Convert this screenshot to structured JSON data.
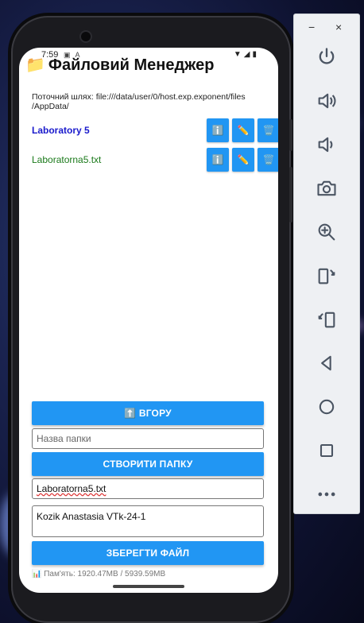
{
  "app": {
    "title": "Файловий Менеджер",
    "title_icon": "📁",
    "status_time": "7:59",
    "status_icons_left": "▣ A",
    "status_icons_right": "▼◢▮"
  },
  "path": {
    "label": "Поточний шлях: file:///data/user/0/host.exp.exponent/files /AppData/"
  },
  "items": [
    {
      "name": "Laboratory 5",
      "kind": "dir",
      "info": "ℹ️",
      "edit": "✏️",
      "delete": "🗑️"
    },
    {
      "name": "Laboratorna5.txt",
      "kind": "file",
      "info": "ℹ️",
      "edit": "✏️",
      "delete": "🗑️"
    }
  ],
  "controls": {
    "up_button": "⬆️ ВГОРУ",
    "folder_placeholder": "Назва папки",
    "create_button": "СТВОРИТИ ПАПКУ",
    "filename_value": "Laboratorna5.txt",
    "content_value": "Kozik Anastasia VTk-24-1",
    "save_button": "ЗБЕРЕГТИ ФАЙЛ"
  },
  "memory": {
    "text": "📊 Пам'ять: 1920.47MB / 5939.59MB"
  },
  "emulator_panel": {
    "minimize": "−",
    "close": "×",
    "buttons": [
      "power-icon",
      "volume-up-icon",
      "volume-down-icon",
      "camera-icon",
      "zoom-in-icon",
      "rotate-left-icon",
      "rotate-right-icon",
      "back-icon",
      "home-icon",
      "overview-icon",
      "more-icon"
    ]
  },
  "colors": {
    "accent": "#2196f3",
    "dir_text": "#1a1acc",
    "file_text": "#1b7a1b"
  }
}
